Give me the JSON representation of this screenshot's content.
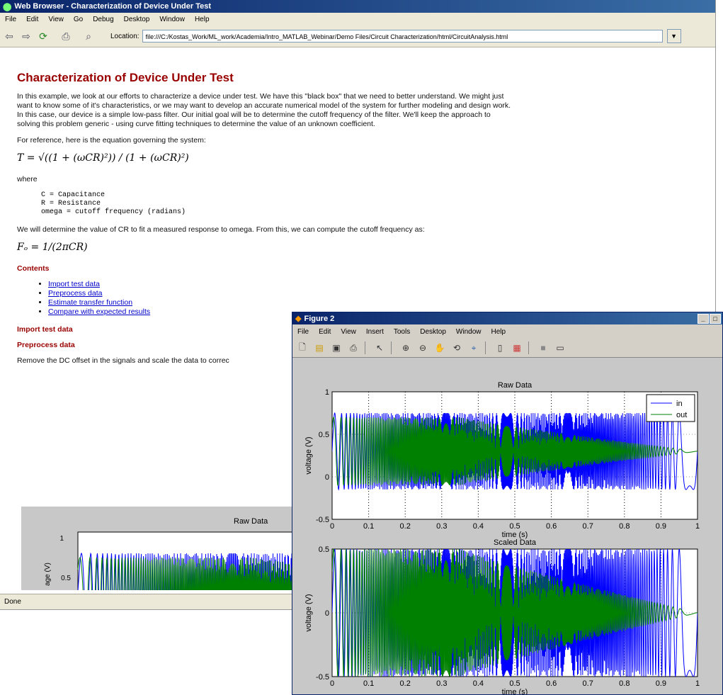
{
  "browser": {
    "title": "Web Browser - Characterization of Device Under Test",
    "menu": [
      "File",
      "Edit",
      "View",
      "Go",
      "Debug",
      "Desktop",
      "Window",
      "Help"
    ],
    "location_label": "Location:",
    "location_value": "file:///C:/Kostas_Work/ML_work/Academia/Intro_MATLAB_Webinar/Demo Files/Circuit Characterization/html/CircuitAnalysis.html",
    "toolbar_icons": [
      "back-arrow-icon",
      "forward-arrow-icon",
      "refresh-icon",
      "print-icon",
      "find-icon"
    ],
    "status": "Done"
  },
  "page": {
    "heading": "Characterization of Device Under Test",
    "intro": "In this example, we look at our efforts to characterize a device under test. We have this \"black box\" that we need to better understand. We might just want to know some of it's characteristics, or we may want to develop an accurate numerical model of the system for further modeling and design work. In this case, our device is a simple low-pass filter. Our initial goal will be to determine the cutoff frequency of the filter. We'll keep the approach to solving this problem generic - using curve fitting techniques to determine the value of an unknown coefficient.",
    "ref_text": "For reference, here is the equation governing the system:",
    "equation": "T = √((1 + (ωCR)²)) / (1 + (ωCR)²)",
    "where": "where",
    "code": "C = Capacitance\nR = Resistance\nomega = cutoff frequency (radians)",
    "determine_text": "We will determine the value of CR to fit a measured response to omega. From this, we can compute the cutoff frequency as:",
    "equation2": "Fₒ = 1/(2πCR)",
    "contents_heading": "Contents",
    "contents": [
      "Import test data",
      "Preprocess data",
      "Estimate transfer function",
      "Compare with expected results"
    ],
    "section1": "Import test data",
    "section2": "Preprocess data",
    "remove_text": "Remove the DC offset in the signals and scale the data to correc",
    "embedded_title": "Raw Data",
    "embedded_ylabel": "age (V)",
    "embedded_ticks": [
      "1",
      "0.5"
    ]
  },
  "figure": {
    "title": "Figure 2",
    "menu": [
      "File",
      "Edit",
      "View",
      "Insert",
      "Tools",
      "Desktop",
      "Window",
      "Help"
    ],
    "toolbar_icons": [
      "new-figure-icon",
      "open-icon",
      "save-icon",
      "print-icon",
      "pointer-icon",
      "zoom-in-icon",
      "zoom-out-icon",
      "pan-icon",
      "rotate-icon",
      "data-cursor-icon",
      "colorbar-icon",
      "legend-icon",
      "hide-tools-icon",
      "dock-icon"
    ]
  },
  "colors": {
    "in": "#0000ff",
    "out": "#008000",
    "heading": "#990000"
  },
  "chart_data": [
    {
      "type": "line",
      "title": "Raw Data",
      "xlabel": "time (s)",
      "ylabel": "voltage (V)",
      "xlim": [
        0,
        1
      ],
      "ylim": [
        -0.5,
        1
      ],
      "xticks": [
        "0",
        "0.1",
        "0.2",
        "0.3",
        "0.4",
        "0.5",
        "0.6",
        "0.7",
        "0.8",
        "0.9",
        "1"
      ],
      "yticks": [
        "-0.5",
        "0",
        "0.5",
        "1"
      ],
      "grid": "vertical-dotted",
      "legend": "top-right",
      "series": [
        {
          "name": "in",
          "kind": "chirp",
          "center": 0.3,
          "amplitude": 0.45
        },
        {
          "name": "out",
          "kind": "decaying-chirp",
          "center": 0.3,
          "amplitude_start": 0.4,
          "amplitude_end": 0.0
        }
      ]
    },
    {
      "type": "line",
      "title": "Scaled Data",
      "xlabel": "time (s)",
      "ylabel": "voltage (V)",
      "xlim": [
        0,
        1
      ],
      "ylim": [
        -0.5,
        0.5
      ],
      "xticks": [
        "0",
        "0.1",
        "0.2",
        "0.3",
        "0.4",
        "0.5",
        "0.6",
        "0.7",
        "0.8",
        "0.9",
        "1"
      ],
      "yticks": [
        "-0.5",
        "0",
        "0.5"
      ],
      "grid": "vertical-dotted",
      "series": [
        {
          "name": "in",
          "kind": "chirp",
          "center": 0.0,
          "amplitude": 0.5
        },
        {
          "name": "out",
          "kind": "decaying-chirp",
          "center": 0.0,
          "amplitude_start": 0.5,
          "amplitude_end": 0.0
        }
      ]
    }
  ]
}
